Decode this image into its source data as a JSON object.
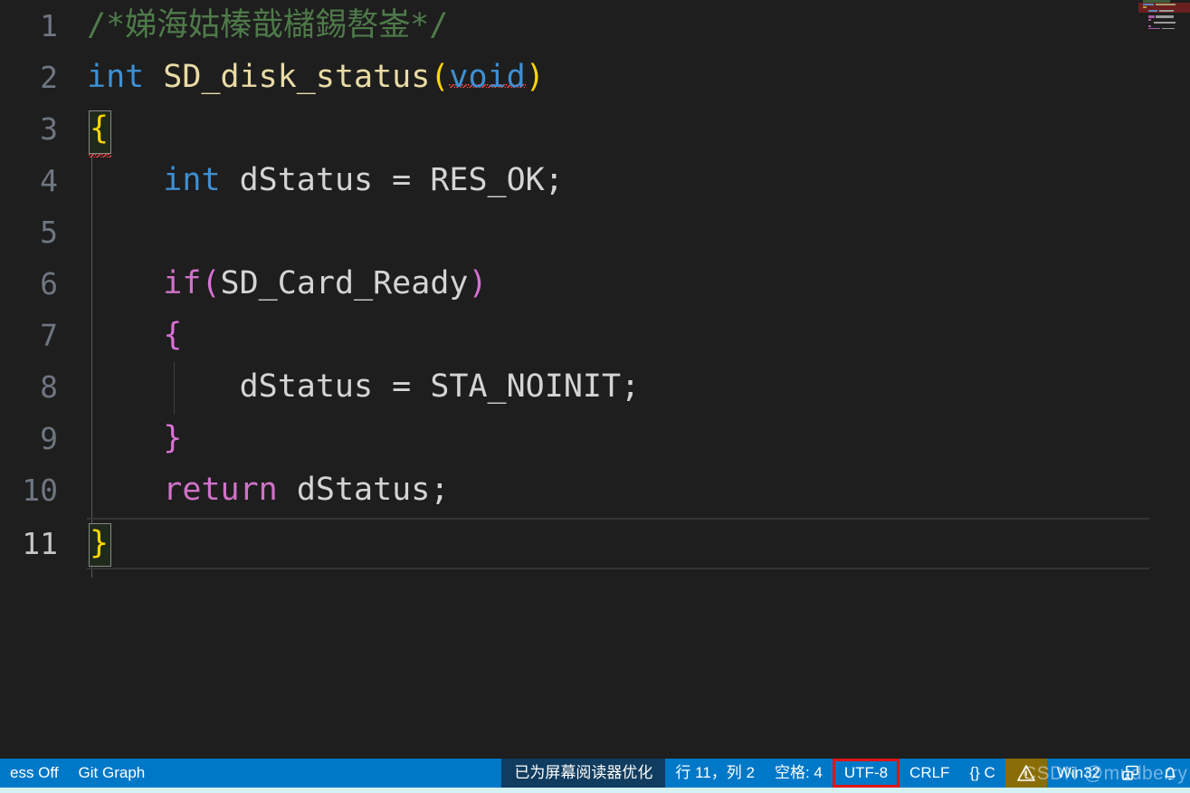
{
  "editor": {
    "language_mode": "C",
    "lines": [
      {
        "number": "1",
        "text": "/*娣海姑榛戠櫧錫嗸崟*/"
      },
      {
        "number": "2",
        "text": "int SD_disk_status(void)"
      },
      {
        "number": "3",
        "text": "{"
      },
      {
        "number": "4",
        "text": "    int dStatus = RES_OK;"
      },
      {
        "number": "5",
        "text": ""
      },
      {
        "number": "6",
        "text": "    if(SD_Card_Ready)"
      },
      {
        "number": "7",
        "text": "    {"
      },
      {
        "number": "8",
        "text": "        dStatus = STA_NOINIT;"
      },
      {
        "number": "9",
        "text": "    }"
      },
      {
        "number": "10",
        "text": "    return dStatus;"
      },
      {
        "number": "11",
        "text": "}"
      }
    ],
    "tokens": {
      "comment": "/*娣海姑榛戠櫧錫嗸崟*/",
      "kw_int": "int",
      "fn_name": "SD_disk_status",
      "paren_open": "(",
      "kw_void": "void",
      "paren_close": ")",
      "brace_open": "{",
      "brace_close": "}",
      "decl_int": "int",
      "var_dstatus": "dStatus",
      "assign": " = ",
      "const_res_ok": "RES_OK;",
      "kw_if": "if",
      "cond_ready": "SD_Card_Ready",
      "const_sta_noinit": "STA_NOINIT;",
      "kw_return": "return",
      "var_dstatus_semicolon": "dStatus;"
    },
    "colors": {
      "background": "#1e1e1e",
      "comment": "#4f7a4a",
      "keyword": "#3f8fd2",
      "control": "#d072c8",
      "function": "#e8dba5",
      "plain": "#d4d4d4",
      "bracket_yellow": "#ffd602",
      "bracket_magenta": "#da70d6",
      "error_squiggle": "#f04747",
      "line_number": "#6e7681"
    }
  },
  "minimap": {
    "name": "minimap",
    "selection_color": "#6b2020"
  },
  "statusbar": {
    "background": "#0078c8",
    "left_items": [
      {
        "name": "prettiness-off",
        "label": "ess Off"
      },
      {
        "name": "git-graph",
        "label": "Git Graph"
      }
    ],
    "right_items": [
      {
        "name": "screen-reader-optimized",
        "label": "已为屏幕阅读器优化"
      },
      {
        "name": "cursor-position",
        "label": "行 11，列 2"
      },
      {
        "name": "indentation",
        "label": "空格: 4"
      },
      {
        "name": "encoding",
        "label": "UTF-8"
      },
      {
        "name": "eol",
        "label": "CRLF"
      },
      {
        "name": "language-mode",
        "label": "{} C"
      },
      {
        "name": "problems-warning",
        "label": ""
      },
      {
        "name": "platform",
        "label": "Win32"
      }
    ],
    "highlight_color": "#e01414",
    "warn_background": "#8b6d07",
    "dark_segment_background": "#103c5f"
  },
  "watermark": {
    "text": "CSDN @mudberry"
  }
}
